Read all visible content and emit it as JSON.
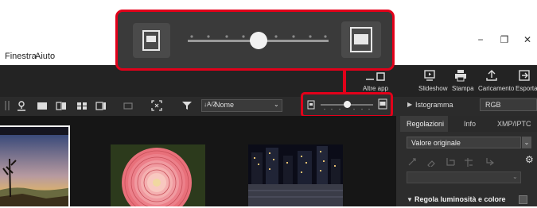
{
  "menu": {
    "items": [
      "Finestra",
      "Aiuto"
    ]
  },
  "window_controls": {
    "minimize": "−",
    "restore": "❐",
    "close": "✕"
  },
  "top_actions": [
    {
      "label": "Altre app",
      "icon": "apps-icon"
    },
    {
      "label": "Slideshow",
      "icon": "slideshow-icon"
    },
    {
      "label": "Stampa",
      "icon": "print-icon"
    },
    {
      "label": "Caricamento",
      "icon": "upload-icon"
    },
    {
      "label": "Esporta",
      "icon": "export-icon"
    }
  ],
  "toolbar": {
    "sort_label": "Nome",
    "sort_prefix": "↓A/Z"
  },
  "thumbnail_size": {
    "level": 0.5
  },
  "right_panel": {
    "histogram_label": "Istogramma",
    "histogram_mode": "RGB",
    "tabs": [
      "Regolazioni",
      "Info",
      "XMP/IPTC"
    ],
    "preset_value": "Valore originale",
    "section_label": "Regola luminosità e colore"
  },
  "colors": {
    "highlight": "#e2001a",
    "dark_bg": "#232323",
    "panel_bg": "#2d2d2d"
  }
}
